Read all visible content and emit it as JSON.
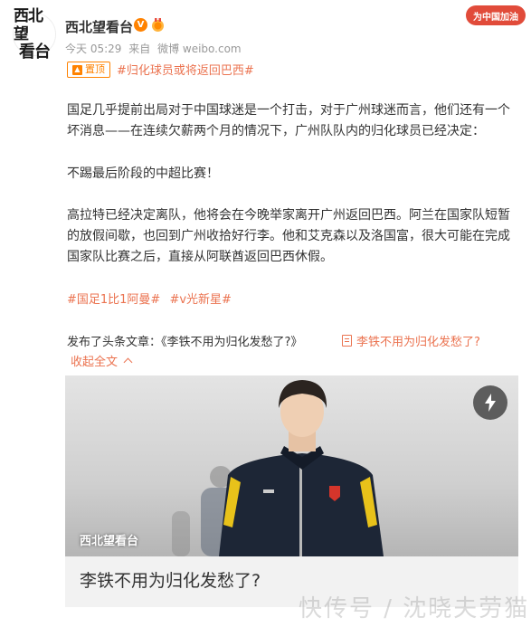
{
  "header": {
    "avatar_line1": "西北望",
    "avatar_line2": "看台",
    "username": "西北望看台",
    "verified_badge": "V",
    "time": "今天 05:29",
    "source_prefix": "来自",
    "source": "微博 weibo.com",
    "promo": "为中国加油"
  },
  "post": {
    "pin_label": "置顶",
    "pin_tag": "#归化球员或将返回巴西#",
    "p1": "国足几乎提前出局对于中国球迷是一个打击，对于广州球迷而言，他们还有一个坏消息——在连续欠薪两个月的情况下，广州队队内的归化球员已经决定：",
    "p2": "不踢最后阶段的中超比赛！",
    "p3": "高拉特已经决定离队，他将会在今晚举家离开广州返回巴西。阿兰在国家队短暂的放假间歇，也回到广州收拾好行李。他和艾克森以及洛国富，很大可能在完成国家队比赛之后，直接从阿联酋返回巴西休假。",
    "hashtag1": "#国足1比1阿曼#",
    "hashtag2": "#v光新星#",
    "article_line": "发布了头条文章：《李铁不用为归化发愁了?》",
    "article_link": "李铁不用为归化发愁了?",
    "collapse": "收起全文"
  },
  "card": {
    "source": "西北望看台",
    "title": "李铁不用为归化发愁了?"
  },
  "watermark": "快传号 / 沈晓夫劳猫",
  "colors": {
    "accent": "#eb7350",
    "orange": "#ff8200",
    "promo": "#e14b3a"
  }
}
